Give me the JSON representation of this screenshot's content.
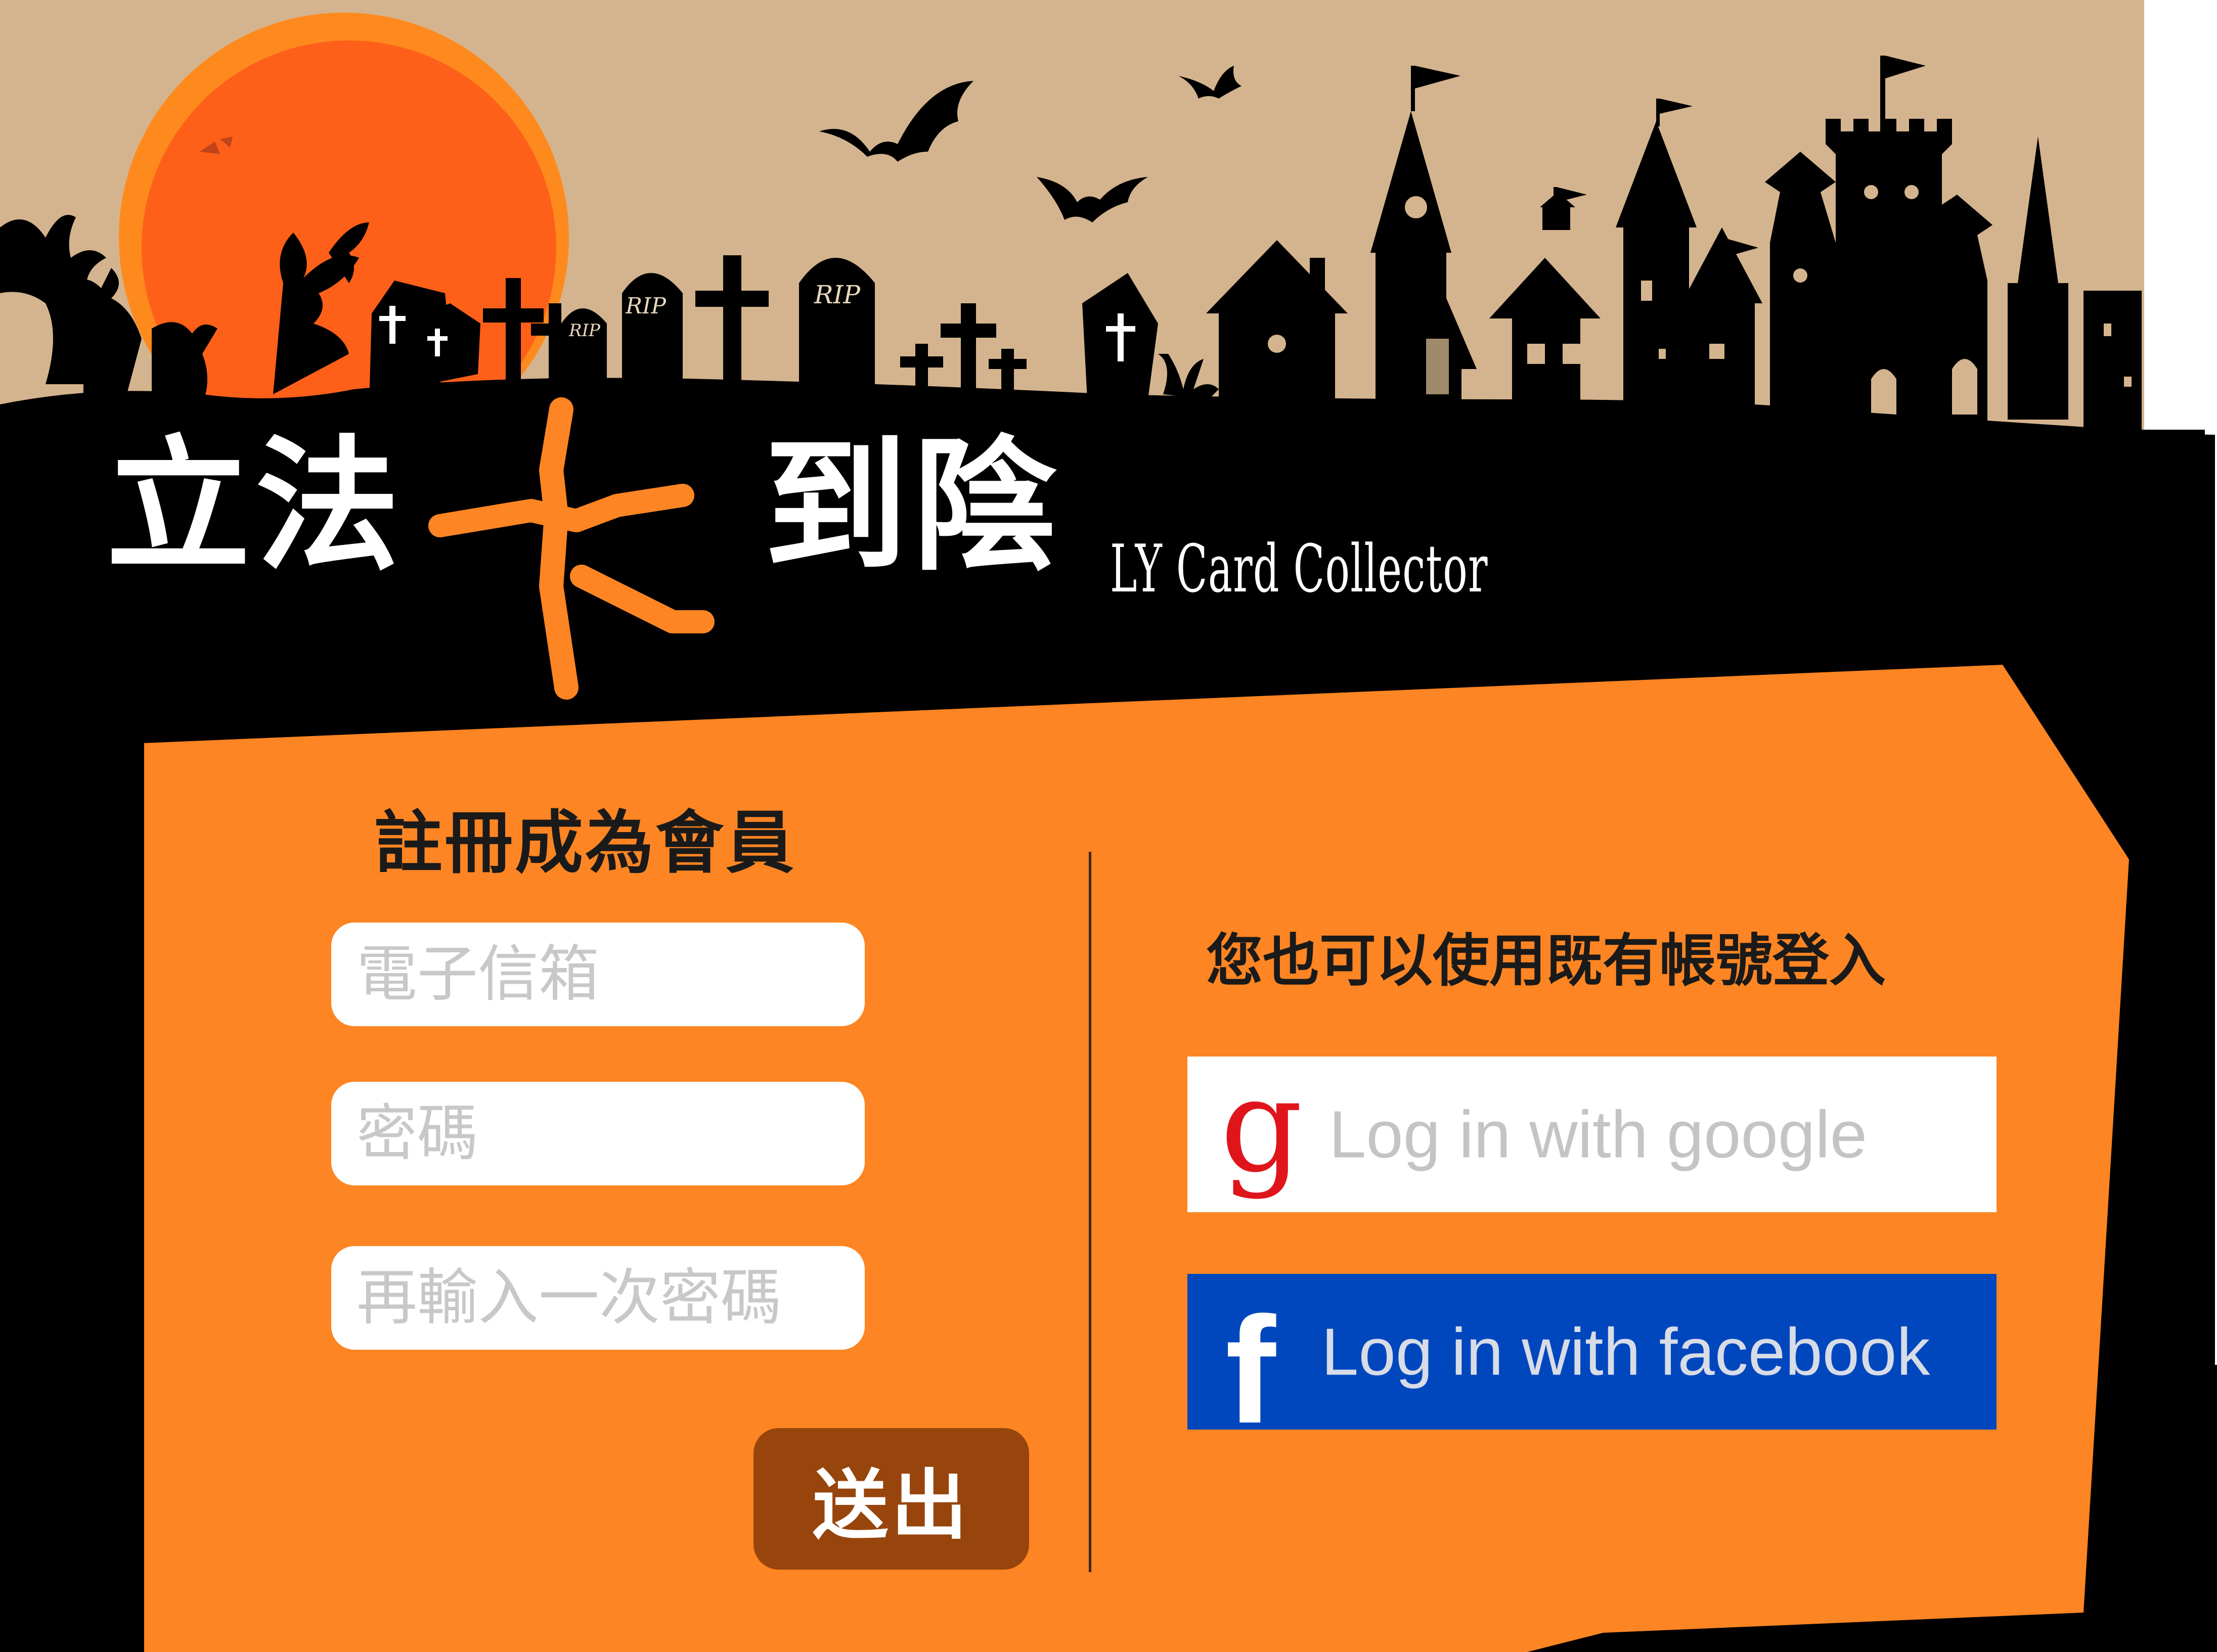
{
  "header": {
    "title_left": "立法",
    "title_right": "到陰",
    "subtitle": "LY Card  Collector"
  },
  "decor": {
    "tombstone_text": "RIP"
  },
  "register": {
    "title": "註冊成為會員",
    "email_placeholder": "電子信箱",
    "password_placeholder": "密碼",
    "confirm_placeholder": "再輸入一次密碼",
    "submit_label": "送出"
  },
  "social": {
    "title": "您也可以使用既有帳號登入",
    "google_label": "Log in with google",
    "google_icon": "g",
    "facebook_label": "Log in with facebook",
    "facebook_icon": "f"
  },
  "colors": {
    "sky": "#d4b48e",
    "ground": "#000000",
    "panel": "#fd8523",
    "moon": "#fe6019",
    "submit": "#97450c",
    "facebook": "#0047be",
    "google_red": "#e0151c"
  }
}
